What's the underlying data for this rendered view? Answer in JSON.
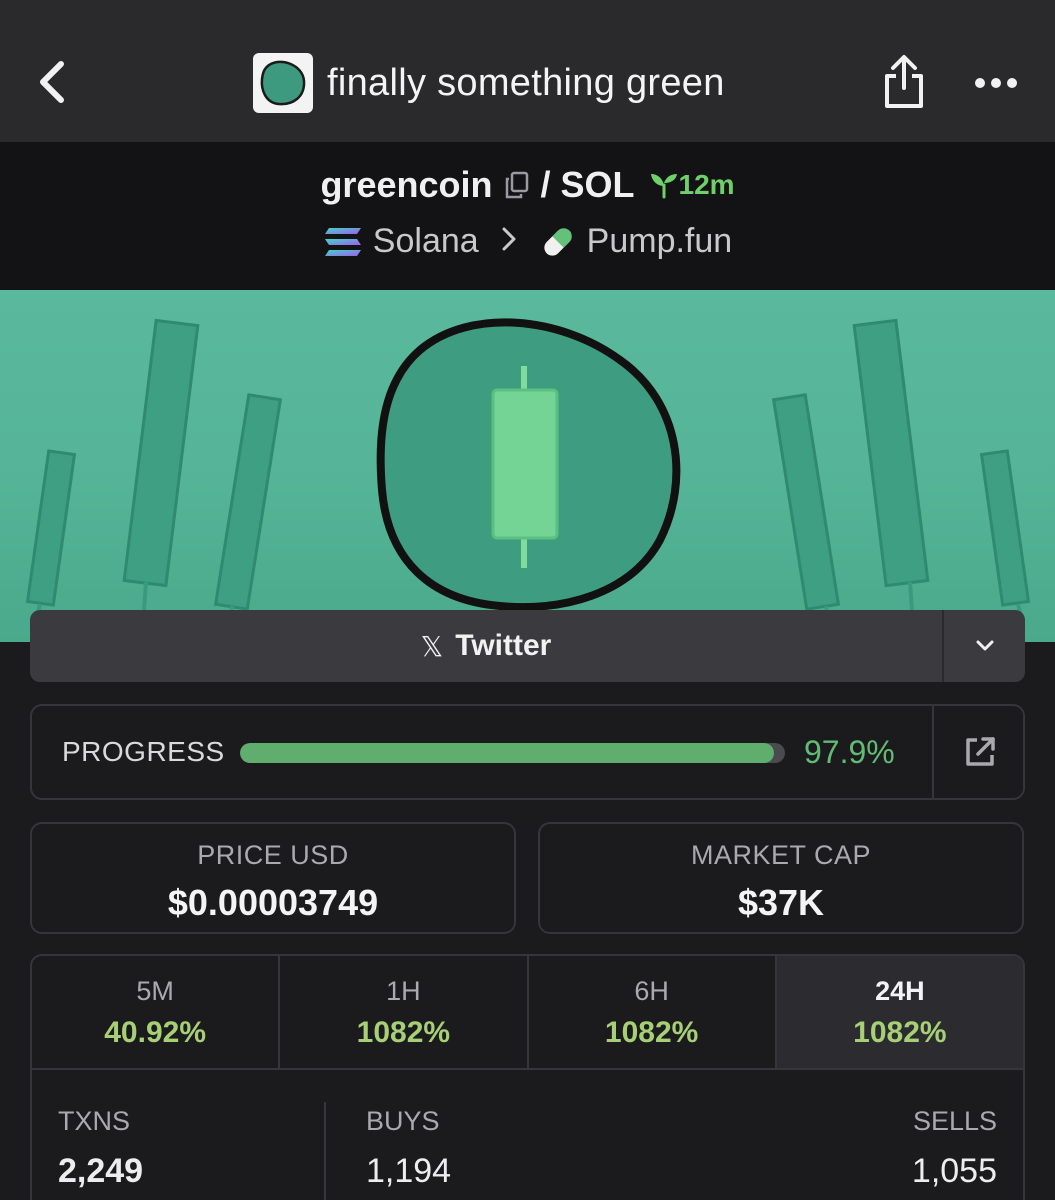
{
  "header": {
    "title": "finally something green",
    "back_icon": "chevron-left-icon",
    "share_icon": "share-icon",
    "more_icon": "more-dots-icon"
  },
  "pair": {
    "base": "greencoin",
    "separator": "/",
    "quote": "SOL",
    "age": "12m",
    "chain": "Solana",
    "dex": "Pump.fun"
  },
  "social": {
    "twitter_label": "Twitter",
    "twitter_glyph": "𝕏"
  },
  "progress": {
    "label": "PROGRESS",
    "value_text": "97.9%",
    "fraction": 0.979
  },
  "stats": {
    "price_label": "PRICE USD",
    "price_value": "$0.00003749",
    "mcap_label": "MARKET CAP",
    "mcap_value": "$37K"
  },
  "timeframes": [
    {
      "label": "5M",
      "change": "40.92%"
    },
    {
      "label": "1H",
      "change": "1082%"
    },
    {
      "label": "6H",
      "change": "1082%"
    },
    {
      "label": "24H",
      "change": "1082%"
    }
  ],
  "txns": {
    "txns_label": "TXNS",
    "txns_value": "2,249",
    "buys_label": "BUYS",
    "buys_value": "1,194",
    "sells_label": "SELLS",
    "sells_value": "1,055"
  },
  "colors": {
    "accent_green": "#62bb74",
    "banner_green": "#55b497",
    "sells_red": "#c9454b",
    "buys_green": "#79b85f"
  }
}
